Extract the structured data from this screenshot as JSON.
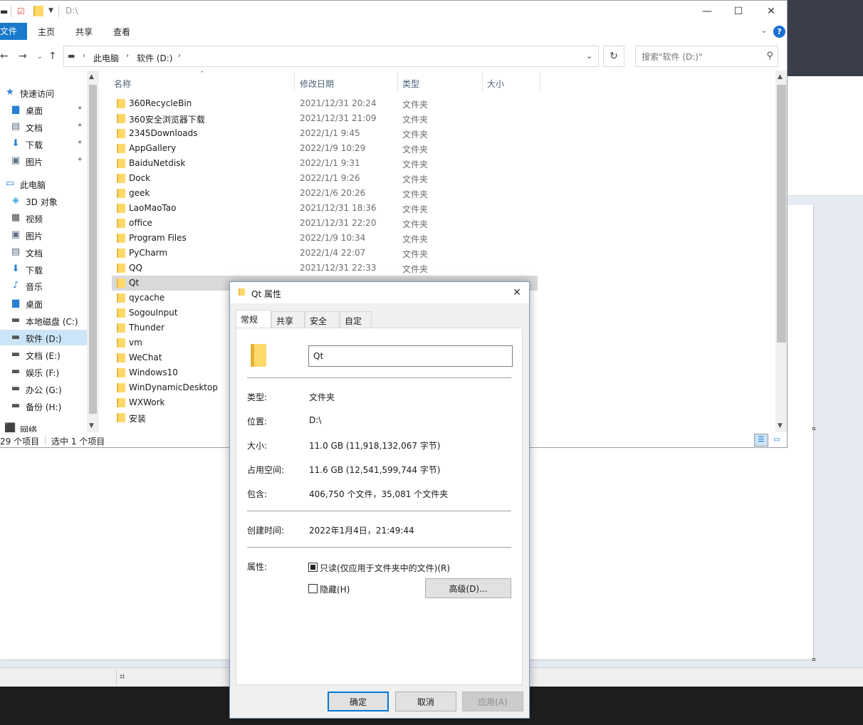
{
  "explorer": {
    "title": "D:\\",
    "ribbon": {
      "file": "文件",
      "home": "主页",
      "share": "共享",
      "view": "查看"
    },
    "address": {
      "crumbs": [
        "此电脑",
        "软件 (D:)"
      ]
    },
    "search": {
      "placeholder": "搜索\"软件 (D:)\""
    },
    "nav": [
      {
        "label": "快速访问",
        "icon": "star-icon",
        "indent": 0
      },
      {
        "label": "桌面",
        "icon": "desktop-icon",
        "indent": 1,
        "pinned": true
      },
      {
        "label": "文档",
        "icon": "document-icon",
        "indent": 1,
        "pinned": true
      },
      {
        "label": "下载",
        "icon": "download-icon",
        "indent": 1,
        "pinned": true
      },
      {
        "label": "图片",
        "icon": "picture-icon",
        "indent": 1,
        "pinned": true
      },
      {
        "label": "此电脑",
        "icon": "computer-icon",
        "indent": 0
      },
      {
        "label": "3D 对象",
        "icon": "cube-icon",
        "indent": 1
      },
      {
        "label": "视频",
        "icon": "video-icon",
        "indent": 1
      },
      {
        "label": "图片",
        "icon": "picture-icon",
        "indent": 1
      },
      {
        "label": "文档",
        "icon": "document-icon",
        "indent": 1
      },
      {
        "label": "下载",
        "icon": "download-icon",
        "indent": 1
      },
      {
        "label": "音乐",
        "icon": "music-icon",
        "indent": 1
      },
      {
        "label": "桌面",
        "icon": "desktop-icon",
        "indent": 1
      },
      {
        "label": "本地磁盘 (C:)",
        "icon": "windows-drive-icon",
        "indent": 1
      },
      {
        "label": "软件 (D:)",
        "icon": "drive-icon",
        "indent": 1,
        "selected": true
      },
      {
        "label": "文档 (E:)",
        "icon": "drive-icon",
        "indent": 1
      },
      {
        "label": "娱乐 (F:)",
        "icon": "drive-icon",
        "indent": 1
      },
      {
        "label": "办公 (G:)",
        "icon": "drive-icon",
        "indent": 1
      },
      {
        "label": "备份 (H:)",
        "icon": "drive-icon",
        "indent": 1
      },
      {
        "label": "网络",
        "icon": "network-icon",
        "indent": 0
      }
    ],
    "columns": {
      "name": "名称",
      "date": "修改日期",
      "type": "类型",
      "size": "大小"
    },
    "files": [
      {
        "name": "360RecycleBin",
        "date": "2021/12/31 20:24",
        "type": "文件夹"
      },
      {
        "name": "360安全浏览器下载",
        "date": "2021/12/31 21:09",
        "type": "文件夹"
      },
      {
        "name": "2345Downloads",
        "date": "2022/1/1 9:45",
        "type": "文件夹"
      },
      {
        "name": "AppGallery",
        "date": "2022/1/9 10:29",
        "type": "文件夹"
      },
      {
        "name": "BaiduNetdisk",
        "date": "2022/1/1 9:31",
        "type": "文件夹"
      },
      {
        "name": "Dock",
        "date": "2022/1/1 9:26",
        "type": "文件夹"
      },
      {
        "name": "geek",
        "date": "2022/1/6 20:26",
        "type": "文件夹"
      },
      {
        "name": "LaoMaoTao",
        "date": "2021/12/31 18:36",
        "type": "文件夹"
      },
      {
        "name": "office",
        "date": "2021/12/31 22:20",
        "type": "文件夹"
      },
      {
        "name": "Program Files",
        "date": "2022/1/9 10:34",
        "type": "文件夹"
      },
      {
        "name": "PyCharm",
        "date": "2022/1/4 22:07",
        "type": "文件夹"
      },
      {
        "name": "QQ",
        "date": "2021/12/31 22:33",
        "type": "文件夹"
      },
      {
        "name": "Qt",
        "date": "",
        "type": "",
        "selected": true
      },
      {
        "name": "qycache",
        "date": "",
        "type": ""
      },
      {
        "name": "SogouInput",
        "date": "",
        "type": ""
      },
      {
        "name": "Thunder",
        "date": "",
        "type": ""
      },
      {
        "name": "vm",
        "date": "",
        "type": ""
      },
      {
        "name": "WeChat",
        "date": "",
        "type": ""
      },
      {
        "name": "Windows10",
        "date": "",
        "type": ""
      },
      {
        "name": "WinDynamicDesktop",
        "date": "",
        "type": ""
      },
      {
        "name": "WXWork",
        "date": "",
        "type": ""
      },
      {
        "name": "安装",
        "date": "",
        "type": ""
      }
    ],
    "status": {
      "count": "29 个项目",
      "selected": "选中 1 个项目"
    }
  },
  "dialog": {
    "title": "Qt 属性",
    "tabs": [
      "常规",
      "共享",
      "安全",
      "自定义"
    ],
    "name_value": "Qt",
    "props": {
      "type_label": "类型:",
      "type_value": "文件夹",
      "location_label": "位置:",
      "location_value": "D:\\",
      "size_label": "大小:",
      "size_value": "11.0 GB (11,918,132,067 字节)",
      "disk_label": "占用空间:",
      "disk_value": "11.6 GB (12,541,599,744 字节)",
      "contains_label": "包含:",
      "contains_value": "406,750 个文件，35,081 个文件夹",
      "created_label": "创建时间:",
      "created_value": "2022年1月4日，21:49:44",
      "attr_label": "属性:"
    },
    "readonly_label": "只读(仅应用于文件夹中的文件)(R)",
    "hidden_label": "隐藏(H)",
    "advanced_label": "高级(D)...",
    "ok_label": "确定",
    "cancel_label": "取消",
    "apply_label": "应用(A)"
  }
}
